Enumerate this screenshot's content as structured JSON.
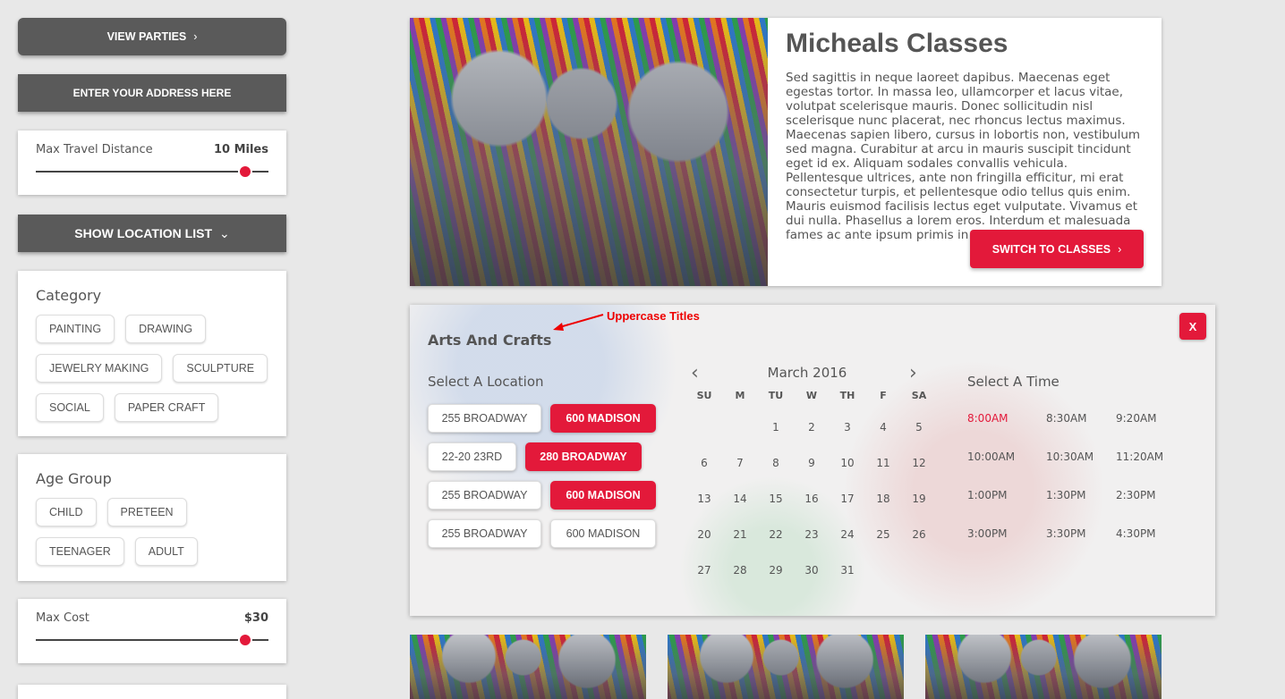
{
  "sidebar": {
    "parties_label": "VIEW PARTIES",
    "address_label": "ENTER YOUR ADDRESS HERE",
    "locations_label": "SHOW LOCATION LIST",
    "travel": {
      "label": "Max Travel Distance",
      "value": "10 Miles",
      "level": 0.9
    },
    "category": {
      "title": "Category",
      "chips": [
        "PAINTING",
        "DRAWING",
        "JEWELRY MAKING",
        "SCULPTURE",
        "SOCIAL",
        "PAPER CRAFT"
      ]
    },
    "age": {
      "title": "Age Group",
      "chips": [
        "CHILD",
        "PRETEEN",
        "TEENAGER",
        "ADULT"
      ]
    },
    "cost": {
      "label": "Max Cost",
      "value": "$30",
      "level": 0.9
    }
  },
  "hero": {
    "title": "Micheals Classes",
    "text": "Sed sagittis in neque laoreet dapibus. Maecenas eget egestas tortor. In massa leo, ullamcorper et lacus vitae, volutpat scelerisque mauris. Donec sollicitudin nisl scelerisque nunc placerat, nec rhoncus lectus maximus. Maecenas sapien libero, cursus in lobortis non, vestibulum sed magna. Curabitur at arcu in mauris suscipit tincidunt eget id ex. Aliquam sodales convallis vehicula. Pellentesque ultrices, ante non fringilla efficitur, mi erat consectetur turpis, et pellentesque odio tellus quis enim. Mauris euismod facilisis lectus eget vulputate. Vivamus et dui nulla. Phasellus a lorem eros. Interdum et malesuada fames ac ante ipsum primis in faucibus.",
    "switch_label": "SWITCH TO CLASSES"
  },
  "panel": {
    "title": "Arts And Crafts",
    "annotation": "Uppercase Titles",
    "close_label": "X",
    "location_label": "Select A Location",
    "locations": [
      {
        "label": "255 BROADWAY",
        "selected": false
      },
      {
        "label": "600 MADISON",
        "selected": true
      },
      {
        "label": "22-20 23RD",
        "selected": false
      },
      {
        "label": "280 BROADWAY",
        "selected": true
      },
      {
        "label": "255 BROADWAY",
        "selected": false
      },
      {
        "label": "600 MADISON",
        "selected": true
      },
      {
        "label": "255 BROADWAY",
        "selected": false
      },
      {
        "label": "600 MADISON",
        "selected": false
      }
    ],
    "calendar": {
      "month": "March 2016",
      "weekdays": [
        "SU",
        "M",
        "TU",
        "W",
        "TH",
        "F",
        "SA"
      ],
      "first_weekday_index": 2,
      "days_in_month": 31
    },
    "time_label": "Select A Time",
    "times": [
      "8:00AM",
      "8:30AM",
      "9:20AM",
      "10:00AM",
      "10:30AM",
      "11:20AM",
      "1:00PM",
      "1:30PM",
      "2:30PM",
      "3:00PM",
      "3:30PM",
      "4:30PM"
    ],
    "selected_time": "8:00AM"
  },
  "colors": {
    "accent": "#e3193a",
    "dark_button": "#5a5a5a",
    "background": "#e8e8e8"
  }
}
